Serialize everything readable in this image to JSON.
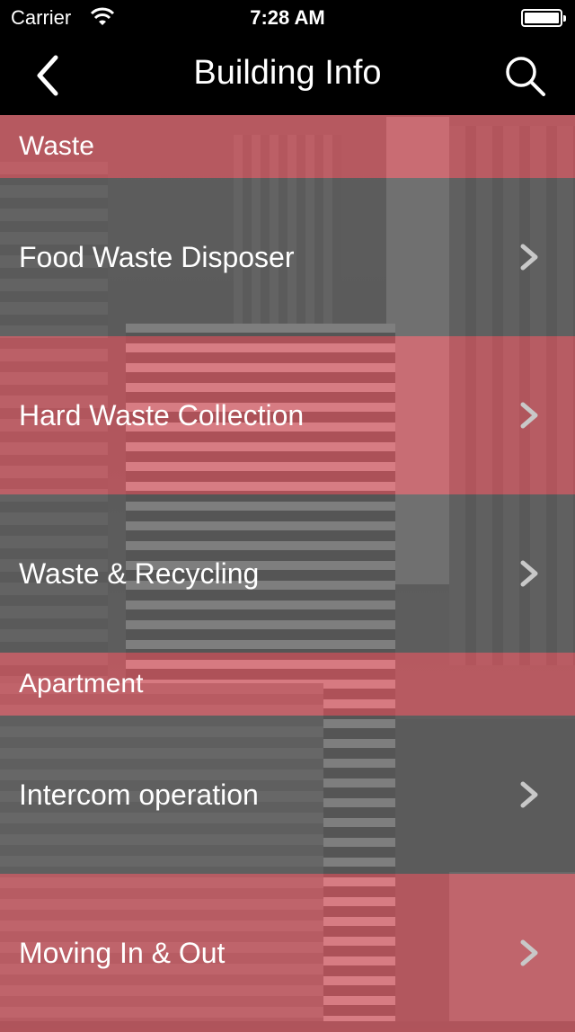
{
  "status_bar": {
    "carrier": "Carrier",
    "time": "7:28 AM"
  },
  "nav": {
    "title": "Building Info",
    "back_icon": "chevron-left-icon",
    "search_icon": "search-icon"
  },
  "sections": [
    {
      "header": "Waste",
      "items": [
        "Food Waste Disposer",
        "Hard Waste Collection",
        "Waste & Recycling"
      ]
    },
    {
      "header": "Apartment",
      "items": [
        "Intercom operation",
        "Moving In & Out"
      ]
    }
  ],
  "colors": {
    "section_overlay": "#d6545e",
    "row_gray_overlay": "#5a5a5a",
    "row_red_overlay": "#d6545e",
    "chevron": "#c8c8c8"
  }
}
